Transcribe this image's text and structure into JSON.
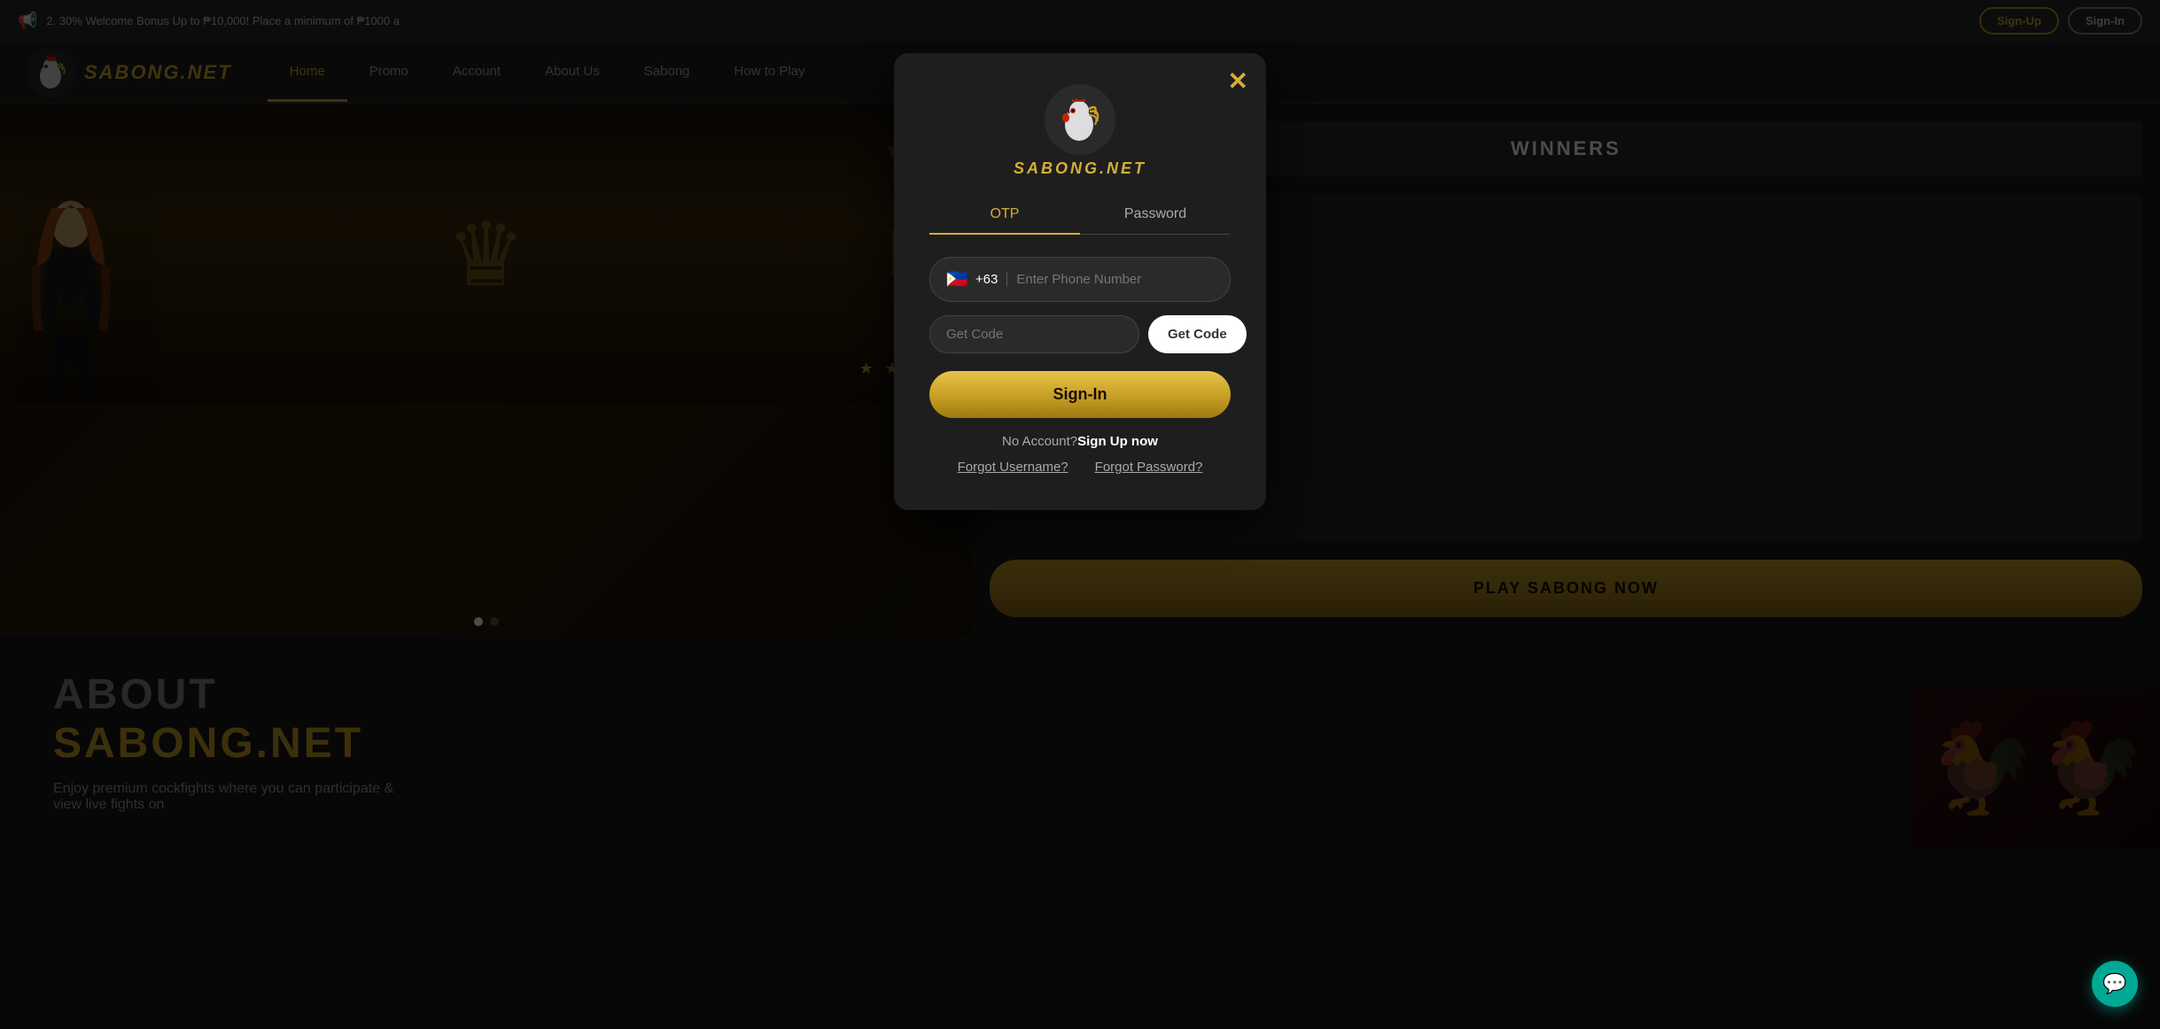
{
  "announcement": {
    "text": "2. 30% Welcome Bonus Up to ₱10,000! Place a minimum of ₱1000 a",
    "signup_label": "Sign-Up",
    "signin_label": "Sign-In"
  },
  "header": {
    "logo_text": "SABONG.NET",
    "nav_items": [
      {
        "id": "home",
        "label": "Home",
        "active": true
      },
      {
        "id": "promo",
        "label": "Promo",
        "active": false
      },
      {
        "id": "account",
        "label": "Account",
        "active": false
      },
      {
        "id": "about",
        "label": "About Us",
        "active": false
      },
      {
        "id": "sabong",
        "label": "Sabong",
        "active": false
      },
      {
        "id": "howtoplay",
        "label": "How to Play",
        "active": false
      }
    ]
  },
  "right_panel": {
    "winners_label": "WINNERS",
    "play_btn_label": "PLAY SABONG NOW"
  },
  "about": {
    "title_line1": "ABOUT",
    "title_line2": "SABONG.NET",
    "description": "Enjoy premium cockfights where you can participate & view live fights on"
  },
  "modal": {
    "logo_text": "SABONG.NET",
    "close_icon": "✕",
    "tabs": [
      {
        "id": "otp",
        "label": "OTP",
        "active": true
      },
      {
        "id": "password",
        "label": "Password",
        "active": false
      }
    ],
    "phone_flag": "🇵🇭",
    "country_code": "+63",
    "phone_placeholder": "Enter Phone Number",
    "code_placeholder": "Get Code",
    "get_code_label": "Get Code",
    "signin_btn_label": "Sign-In",
    "no_account_text": "No Account?",
    "signup_now_label": "Sign Up now",
    "forgot_username_label": "Forgot Username?",
    "forgot_password_label": "Forgot Password?"
  },
  "slide_dots": [
    {
      "active": true
    },
    {
      "active": false
    }
  ],
  "chat_icon": "💬",
  "colors": {
    "gold": "#d4af37",
    "dark_bg": "#1e1e1e",
    "accent": "#c9a227"
  }
}
